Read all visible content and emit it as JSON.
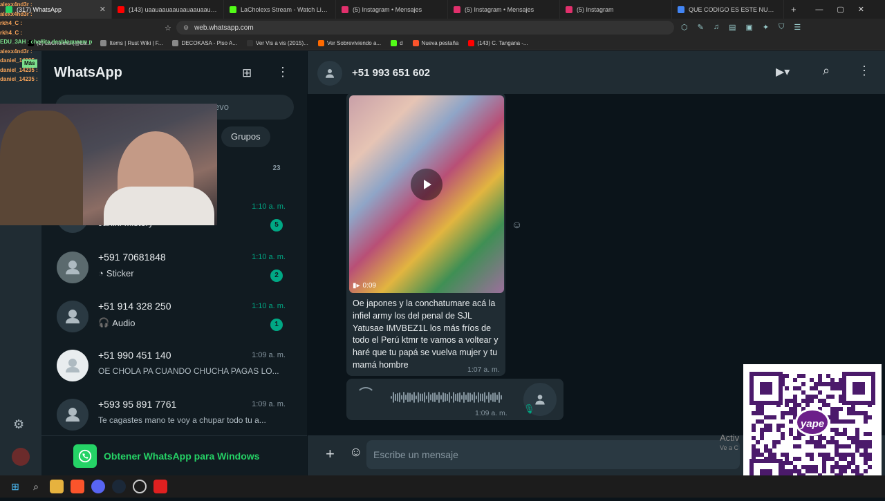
{
  "browser": {
    "tabs": [
      {
        "label": "(317) WhatsApp",
        "color": "#25d366",
        "active": true
      },
      {
        "label": "(143) uaauaauaauaauaauaauaauaau",
        "color": "#ff0000",
        "active": false
      },
      {
        "label": "LaCholexs Stream - Watch Live on Ki",
        "color": "#53fc18",
        "active": false
      },
      {
        "label": "(5) Instagram • Mensajes",
        "color": "#e1306c",
        "active": false
      },
      {
        "label": "(5) Instagram • Mensajes",
        "color": "#e1306c",
        "active": false
      },
      {
        "label": "(5) Instagram",
        "color": "#e1306c",
        "active": false
      },
      {
        "label": "QUE CODIGO ES ESTE NUMERO +5",
        "color": "#4285f4",
        "active": false
      }
    ],
    "url": "web.whatsapp.com",
    "bookmarks": [
      {
        "label": "(2) LaCholexs (@La...",
        "color": "#000000"
      },
      {
        "label": "Items | Rust Wiki | F...",
        "color": "#888888"
      },
      {
        "label": "DECOKASA - Piso A...",
        "color": "#888888"
      },
      {
        "label": "Ver Vis a vis (2015)...",
        "color": "#333333"
      },
      {
        "label": "Ver Sobreviviendo a...",
        "color": "#ff6a00"
      },
      {
        "label": "d",
        "color": "#53fc18"
      },
      {
        "label": "Nueva pestaña",
        "color": "#fb542b"
      },
      {
        "label": "(143) C. Tangana -...",
        "color": "#ff0000"
      }
    ]
  },
  "sidebar": {
    "title": "WhatsApp",
    "search_placeholder": "evo",
    "filter_groups": "Grupos",
    "get_app": "Obtener WhatsApp para Windows",
    "chats": [
      {
        "name": "",
        "message": "",
        "time": "",
        "badge": "23"
      },
      {
        "name": "",
        "message": "Janix: Mistery",
        "time": "1:10 a. m.",
        "badge": "5"
      },
      {
        "name": "+591 70681848",
        "message": "Sticker",
        "time": "1:10 a. m.",
        "badge": "2",
        "icon": "sticker-icon"
      },
      {
        "name": "+51 914 328 250",
        "message": "Audio",
        "time": "1:10 a. m.",
        "badge": "1",
        "icon": "headphones-icon"
      },
      {
        "name": "+51 990 451 140",
        "message": "OE CHOLA PA CUANDO CHUCHA PAGAS LO...",
        "time": "1:09 a. m.",
        "badge": ""
      },
      {
        "name": "+593 95 891 7761",
        "message": "Te cagastes mano te voy a chupar todo tu a...",
        "time": "1:09 a. m.",
        "badge": ""
      }
    ]
  },
  "chat": {
    "contact": "+51 993 651 602",
    "video_duration": "0:09",
    "caption": "Oe japones y la conchatumare acá la infiel army los del penal de SJL Yatusae IMVBEZ1L los más fríos de todo el Perú ktmr te vamos a voltear y haré que tu papá se vuelva mujer y tu mamá hombre",
    "caption_time": "1:07 a. m.",
    "audio_time": "1:09 a. m.",
    "composer_placeholder": "Escribe un mensaje"
  },
  "overlay": {
    "chat_users": [
      {
        "user": "alexx4nd3r :",
        "color": "#f4a259"
      },
      {
        "user": "alexx4nd3r :",
        "color": "#f4a259"
      },
      {
        "user": "rkh4_C :",
        "color": "#f4a259"
      },
      {
        "user": "rkh4_C :",
        "color": "#f4a259"
      },
      {
        "user": "EDU_3AH : chollita desbloqueam p",
        "color": "#7be08c"
      },
      {
        "user": "alexx4nd3r :",
        "color": "#f4a259"
      },
      {
        "user": "daniel_14235 :",
        "color": "#f4a259"
      },
      {
        "user": "daniel_14235 :",
        "color": "#f4a259"
      },
      {
        "user": "daniel_14235 :",
        "color": "#f4a259"
      }
    ],
    "mas": "Más",
    "activate_windows": "Activ",
    "activate_sub": "Ve a C",
    "qr_brand": "yape"
  },
  "colors": {
    "accent": "#00a884",
    "panel": "#202c33",
    "bg": "#111b21"
  }
}
